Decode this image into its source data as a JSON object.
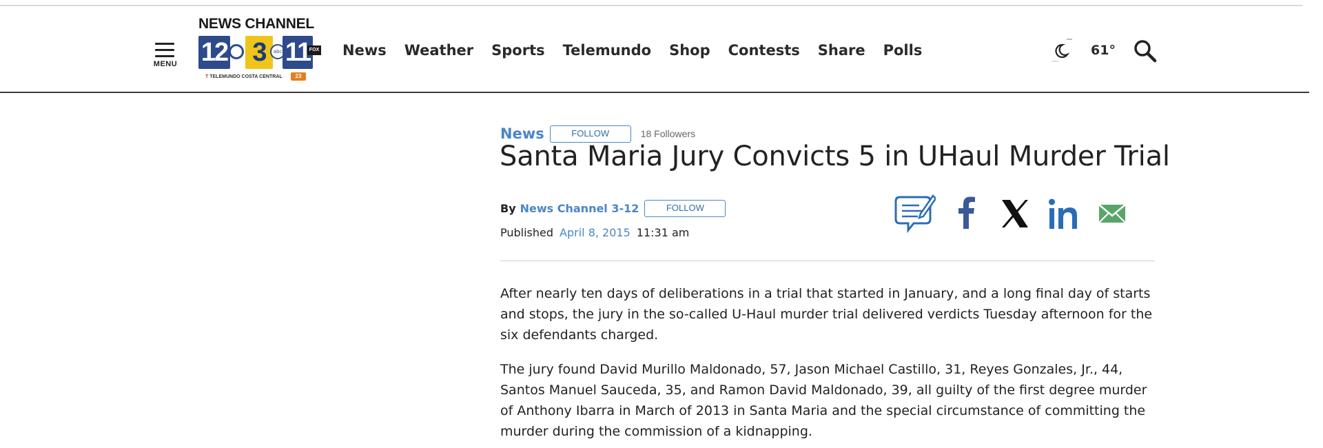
{
  "header": {
    "menu_label": "MENU",
    "logo": {
      "brand": "NEWS CHANNEL",
      "channels": [
        "12",
        "3",
        "11"
      ],
      "network_marks": [
        "cbs",
        "abc",
        "FOX"
      ],
      "sub": "TELEMUNDO COSTA CENTRAL",
      "sub_badge": "23"
    },
    "nav": [
      "News",
      "Weather",
      "Sports",
      "Telemundo",
      "Shop",
      "Contests",
      "Share",
      "Polls"
    ],
    "weather": {
      "temp": "61°",
      "icon": "moon-cloud-icon"
    },
    "search_icon": "search-icon"
  },
  "article": {
    "section": "News",
    "section_follow": "FOLLOW",
    "followers": "18 Followers",
    "headline": "Santa Maria Jury Convicts 5 in UHaul Murder Trial",
    "byline": {
      "by": "By",
      "author": "News Channel 3-12",
      "follow": "FOLLOW"
    },
    "published": {
      "label": "Published",
      "date": "April 8, 2015",
      "time": "11:31 am"
    },
    "share_icons": [
      "comment-icon",
      "facebook-icon",
      "x-icon",
      "linkedin-icon",
      "email-icon"
    ],
    "paragraphs": [
      "After nearly ten days of deliberations in a trial that started in January, and a long final day of starts and stops, the jury in the so-called U-Haul murder trial delivered verdicts Tuesday afternoon for the six defendants charged.",
      "The jury found David Murillo Maldonado, 57, Jason Michael Castillo, 31, Reyes Gonzales, Jr., 44, Santos Manuel Sauceda, 35, and Ramon David Maldonado, 39, all guilty of the first degree murder of Anthony Ibarra in March of 2013 in Santa Maria and the special circumstance of committing the murder during the commission of a kidnapping."
    ]
  },
  "colors": {
    "accent_blue": "#4a86c5",
    "logo_blue": "#2d4a8a",
    "logo_yellow": "#f0c419",
    "facebook": "#3b5998",
    "linkedin": "#2a6db5",
    "email_green": "#5aa66a",
    "text": "#222222"
  }
}
